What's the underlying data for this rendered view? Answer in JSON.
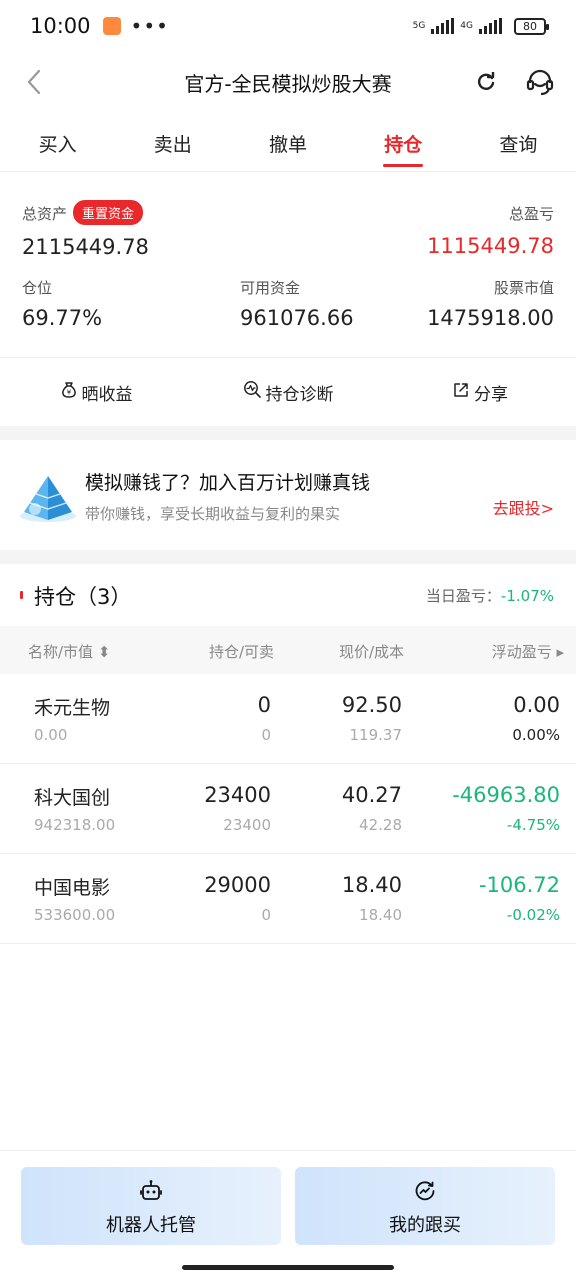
{
  "status_bar": {
    "time": "10:00",
    "dots": "•••",
    "net1": "5G",
    "net2": "4G",
    "battery": "80"
  },
  "header": {
    "title": "官方-全民模拟炒股大赛"
  },
  "tabs": [
    {
      "label": "买入"
    },
    {
      "label": "卖出"
    },
    {
      "label": "撤单"
    },
    {
      "label": "持仓",
      "active": true
    },
    {
      "label": "查询"
    }
  ],
  "summary": {
    "total_assets_label": "总资产",
    "reset_label": "重置资金",
    "total_assets_value": "2115449.78",
    "total_pl_label": "总盈亏",
    "total_pl_value": "1115449.78",
    "position_ratio_label": "仓位",
    "position_ratio_value": "69.77%",
    "available_label": "可用资金",
    "available_value": "961076.66",
    "stock_value_label": "股票市值",
    "stock_value_value": "1475918.00"
  },
  "actions": [
    {
      "label": "晒收益",
      "icon": "money-bag-icon"
    },
    {
      "label": "持仓诊断",
      "icon": "diagnosis-icon"
    },
    {
      "label": "分享",
      "icon": "share-icon"
    }
  ],
  "promo": {
    "title": "模拟赚钱了？加入百万计划赚真钱",
    "subtitle": "带你赚钱，享受长期收益与复利的果实",
    "link": "去跟投>"
  },
  "positions": {
    "title": "持仓（3）",
    "day_pl_label": "当日盈亏：",
    "day_pl_value": "-1.07%",
    "columns": {
      "name": "名称/市值 ⬍",
      "hold": "持仓/可卖",
      "price": "现价/成本",
      "pl": "浮动盈亏 ▸"
    },
    "rows": [
      {
        "name": "禾元生物",
        "market_value": "0.00",
        "hold": "0",
        "sellable": "0",
        "price": "92.50",
        "cost": "119.37",
        "pl": "0.00",
        "pl_pct": "0.00%"
      },
      {
        "name": "科大国创",
        "market_value": "942318.00",
        "hold": "23400",
        "sellable": "23400",
        "price": "40.27",
        "cost": "42.28",
        "pl": "-46963.80",
        "pl_pct": "-4.75%"
      },
      {
        "name": "中国电影",
        "market_value": "533600.00",
        "hold": "29000",
        "sellable": "0",
        "price": "18.40",
        "cost": "18.40",
        "pl": "-106.72",
        "pl_pct": "-0.02%"
      }
    ]
  },
  "bottom": {
    "robot_label": "机器人托管",
    "follow_label": "我的跟买"
  },
  "colors": {
    "accent_red": "#e8282b",
    "loss_green": "#1ab67a",
    "neutral": "#222222"
  }
}
